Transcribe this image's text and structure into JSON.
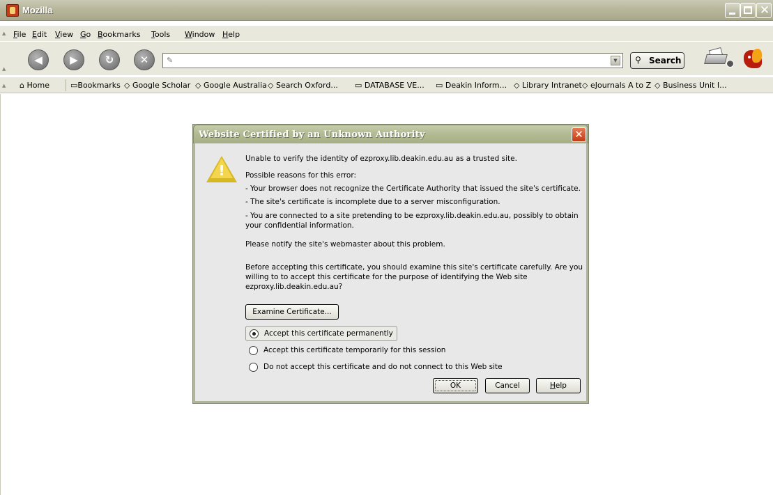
{
  "window": {
    "title": "Mozilla"
  },
  "menu": {
    "items": [
      {
        "label": "File",
        "accel": "F",
        "rest": "ile"
      },
      {
        "label": "Edit",
        "accel": "E",
        "rest": "dit"
      },
      {
        "label": "View",
        "accel": "V",
        "rest": "iew"
      },
      {
        "label": "Go",
        "accel": "G",
        "rest": "o"
      },
      {
        "label": "Bookmarks",
        "accel": "B",
        "rest": "ookmarks"
      },
      {
        "label": "Tools",
        "accel": "T",
        "rest": "ools"
      },
      {
        "label": "Window",
        "accel": "W",
        "rest": "indow"
      },
      {
        "label": "Help",
        "accel": "H",
        "rest": "elp"
      }
    ]
  },
  "navigation": {
    "back_icon": "back-arrow-icon",
    "forward_icon": "forward-arrow-icon",
    "reload_icon": "reload-icon",
    "stop_icon": "stop-icon",
    "url_value": "",
    "search_label": "Search"
  },
  "bookmarks": {
    "items": [
      {
        "label": "Home",
        "icon": "home-icon"
      },
      {
        "label": "Bookmarks",
        "icon": "folder-icon"
      },
      {
        "label": "Google Scholar",
        "icon": "bookmark-icon"
      },
      {
        "label": "Google Australia",
        "icon": "bookmark-icon"
      },
      {
        "label": "Search Oxford...",
        "icon": "bookmark-icon"
      },
      {
        "label": "DATABASE VE...",
        "icon": "folder-icon"
      },
      {
        "label": "Deakin Inform...",
        "icon": "folder-icon"
      },
      {
        "label": "Library Intranet",
        "icon": "bookmark-icon"
      },
      {
        "label": "eJournals A to Z",
        "icon": "bookmark-icon"
      },
      {
        "label": "Business Unit I...",
        "icon": "bookmark-icon"
      }
    ]
  },
  "dialog": {
    "title": "Website Certified by an Unknown Authority",
    "lines": [
      "Unable to verify the identity of ezproxy.lib.deakin.edu.au as a trusted site.",
      "Possible reasons for this error:",
      "- Your browser does not recognize the Certificate Authority that issued the site's certificate.",
      "- The site's certificate is incomplete due to a server misconfiguration.",
      "- You are connected to a site pretending to be ezproxy.lib.deakin.edu.au, possibly to obtain",
      "your confidential information.",
      "Please notify the site's webmaster about this problem.",
      "Before accepting this certificate, you should examine this site's certificate carefully. Are you",
      "willing to to accept this certificate for the purpose of identifying the Web site",
      "ezproxy.lib.deakin.edu.au?"
    ],
    "examine_label": "Examine Certificate...",
    "options": [
      {
        "label": "Accept this certificate permanently",
        "checked": true
      },
      {
        "label": "Accept this certificate temporarily for this session",
        "checked": false
      },
      {
        "label": "Do not accept this certificate and do not connect to this Web site",
        "checked": false
      }
    ],
    "ok_label": "OK",
    "cancel_label": "Cancel",
    "help_label": "Help"
  },
  "colors": {
    "chrome": "#e9e8dc",
    "titlebar": "#b8b79c",
    "dialog_title": "#b2ba93",
    "dialog_close": "#c43a12",
    "warning": "#f3d64d"
  }
}
